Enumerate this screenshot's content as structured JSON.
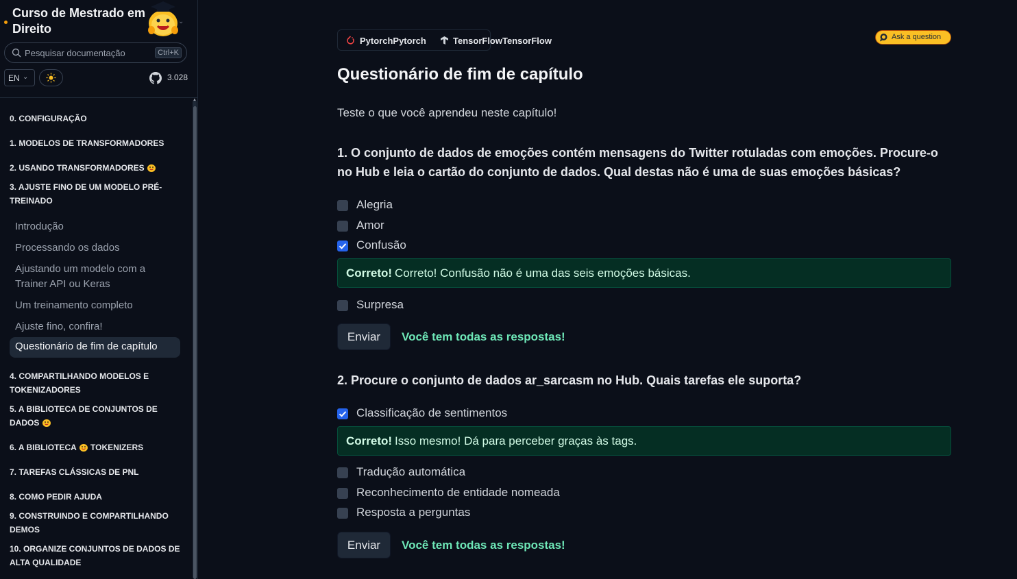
{
  "sidebar": {
    "title": "Curso de Mestrado em Direito",
    "search_placeholder": "Pesquisar documentação",
    "search_shortcut": "Ctrl+K",
    "language": "EN",
    "github_stars": "3.028",
    "chapters": [
      {
        "label": "0. CONFIGURAÇÃO"
      },
      {
        "label": "1. MODELOS DE TRANSFORMADORES"
      },
      {
        "label": "2. USANDO TRANSFORMADORES"
      },
      {
        "label": "3. AJUSTE FINO DE UM MODELO PRÉ-TREINADO"
      },
      {
        "label": "4. COMPARTILHANDO MODELOS E TOKENIZADORES"
      },
      {
        "label": "5. A BIBLIOTECA DE CONJUNTOS DE DADOS"
      },
      {
        "label_a": "6. A BIBLIOTECA",
        "label_b": "TOKENIZERS"
      },
      {
        "label": "7. TAREFAS CLÁSSICAS DE PNL"
      },
      {
        "label": "8. COMO PEDIR AJUDA"
      },
      {
        "label": "9. CONSTRUINDO E COMPARTILHANDO DEMOS"
      },
      {
        "label": "10. ORGANIZE CONJUNTOS DE DADOS DE ALTA QUALIDADE"
      }
    ],
    "subitems": [
      {
        "label": "Introdução"
      },
      {
        "label": "Processando os dados"
      },
      {
        "label": "Ajustando um modelo com a Trainer API ou Keras"
      },
      {
        "label": "Um treinamento completo"
      },
      {
        "label": "Ajuste fino, confira!"
      },
      {
        "label": "Questionário de fim de capítulo"
      }
    ]
  },
  "frameworks": {
    "pytorch": "PytorchPytorch",
    "tensorflow": "TensorFlowTensorFlow"
  },
  "ask_label": "Ask a question",
  "page_title": "Questionário de fim de capítulo",
  "intro": "Teste o que você aprendeu neste capítulo!",
  "questions": [
    {
      "text": "1. O conjunto de dados de emoções contém mensagens do Twitter rotuladas com emoções. Procure-o no Hub e leia o cartão do conjunto de dados. Qual destas não é uma de suas emoções básicas?",
      "options": [
        {
          "label": "Alegria",
          "checked": false
        },
        {
          "label": "Amor",
          "checked": false
        },
        {
          "label": "Confusão",
          "checked": true
        },
        {
          "label": "Surpresa",
          "checked": false
        }
      ],
      "feedback_strong": "Correto!",
      "feedback_text": "Correto! Confusão não é uma das seis emoções básicas.",
      "submit_label": "Enviar",
      "result": "Você tem todas as respostas!"
    },
    {
      "text": "2. Procure o conjunto de dados ar_sarcasm no Hub. Quais tarefas ele suporta?",
      "options": [
        {
          "label": "Classificação de sentimentos",
          "checked": true
        },
        {
          "label": "Tradução automática",
          "checked": false
        },
        {
          "label": "Reconhecimento de entidade nomeada",
          "checked": false
        },
        {
          "label": "Resposta a perguntas",
          "checked": false
        }
      ],
      "feedback_strong": "Correto!",
      "feedback_text": "Isso mesmo! Dá para perceber graças às tags.",
      "submit_label": "Enviar",
      "result": "Você tem todas as respostas!"
    }
  ],
  "colors": {
    "background": "#0b0f19",
    "accent_check": "#2563eb",
    "success_bg": "#052e23",
    "success_text": "#6ee7b7",
    "ask_button": "#fbbf24"
  }
}
